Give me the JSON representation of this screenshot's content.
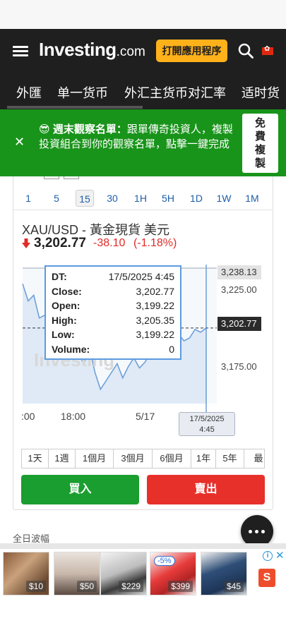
{
  "header": {
    "logo_main": "Investing",
    "logo_suffix": ".com",
    "open_app_label": "打開應用程序"
  },
  "tabs": [
    "外匯",
    "单一货币",
    "外汇主货币对汇率",
    "适时货"
  ],
  "banner": {
    "emoji": "😎",
    "title": "週末觀察名單：",
    "text": "跟單傳奇投資人，複製投資組合到你的觀察名單，點擊一鍵完成",
    "button_lines": [
      "免",
      "費",
      "複",
      "製"
    ]
  },
  "timeframes": [
    "1",
    "5",
    "15",
    "30",
    "1H",
    "5H",
    "1D",
    "1W",
    "1M"
  ],
  "active_timeframe": "15",
  "instrument": {
    "title": "XAU/USD - 黃金現貨 美元",
    "price": "3,202.77",
    "change": "-38.10",
    "change_pct": "(-1.18%)"
  },
  "chart_data": {
    "type": "area",
    "x_tick_labels": [
      ":00",
      "18:00",
      "5/17"
    ],
    "y_tick_labels": [
      "3,225.00",
      "3,175.00"
    ],
    "y_highlight_labels": [
      "3,238.13",
      "3,202.77"
    ],
    "ylim": [
      3150,
      3245
    ],
    "watermark": "Investing",
    "series": [
      {
        "values": [
          3234,
          3222,
          3226,
          3210,
          3212,
          3214,
          3205,
          3210,
          3200,
          3195,
          3185,
          3178,
          3190,
          3172,
          3160,
          3166,
          3172,
          3178,
          3168,
          3176,
          3182,
          3175,
          3179,
          3186,
          3190,
          3195,
          3188,
          3192,
          3199,
          3194,
          3196,
          3202,
          3200,
          3203
        ]
      }
    ],
    "crosshair_date": [
      "17/5/2025",
      "4:45"
    ]
  },
  "tooltip": [
    {
      "key": "DT:",
      "value": "17/5/2025 4:45"
    },
    {
      "key": "Close:",
      "value": "3,202.77"
    },
    {
      "key": "Open:",
      "value": "3,199.22"
    },
    {
      "key": "High:",
      "value": "3,205.35"
    },
    {
      "key": "Low:",
      "value": "3,199.22"
    },
    {
      "key": "Volume:",
      "value": "0"
    }
  ],
  "ranges": [
    "1天",
    "1週",
    "1個月",
    "3個月",
    "6個月",
    "1年",
    "5年",
    "最"
  ],
  "buy_label": "買入",
  "sell_label": "賣出",
  "daily_range_label": "全日波幅",
  "ads": [
    "$10",
    "$50",
    "$229",
    "$399",
    "$45"
  ],
  "ad_discount": "-5%",
  "colors": {
    "header_bg": "#1f1f1f",
    "accent": "#ffb11a",
    "banner_bg": "#19941a",
    "buy": "#1a9e2f",
    "sell": "#e8302a",
    "down": "#e02b27"
  }
}
